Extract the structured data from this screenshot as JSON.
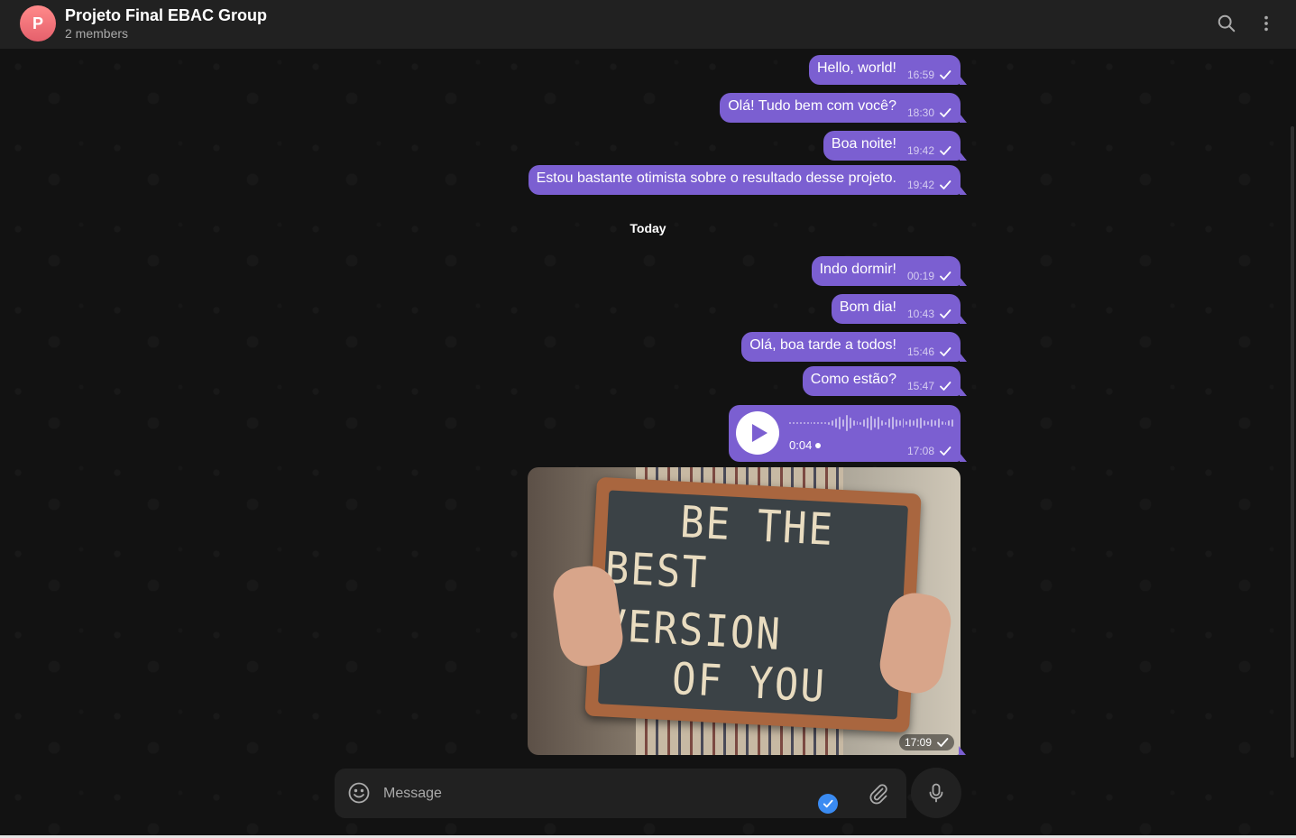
{
  "header": {
    "avatar_letter": "P",
    "title": "Projeto Final EBAC Group",
    "subtitle": "2 members"
  },
  "messages_before": [
    {
      "text": "Hello, world!",
      "time": "16:59"
    },
    {
      "text": "Olá! Tudo bem com você?",
      "time": "18:30"
    },
    {
      "text": "Boa noite!",
      "time": "19:42"
    },
    {
      "text": "Estou bastante otimista sobre o resultado desse projeto.",
      "time": "19:42"
    }
  ],
  "date_separator": "Today",
  "messages_today": [
    {
      "text": "Indo dormir!",
      "time": "00:19"
    },
    {
      "text": "Bom dia!",
      "time": "10:43"
    },
    {
      "text": "Olá, boa tarde a todos!",
      "time": "15:46"
    },
    {
      "text": "Como estão?",
      "time": "15:47"
    }
  ],
  "voice_message": {
    "duration": "0:04",
    "time": "17:08"
  },
  "photo_message": {
    "time": "17:09",
    "board_lines": [
      "BE THE",
      "BEST VERSION",
      "OF YOU"
    ]
  },
  "composer": {
    "placeholder": "Message"
  },
  "icons": {
    "search": "search-icon",
    "more": "more-vertical-icon",
    "emoji": "emoji-icon",
    "attach": "paperclip-icon",
    "mic": "microphone-icon",
    "play": "play-icon",
    "check": "check-icon",
    "verified": "verified-badge-icon"
  },
  "colors": {
    "bubble": "#7b5fd1",
    "header": "#212121",
    "background": "#121212",
    "avatar": "#e5606c"
  }
}
